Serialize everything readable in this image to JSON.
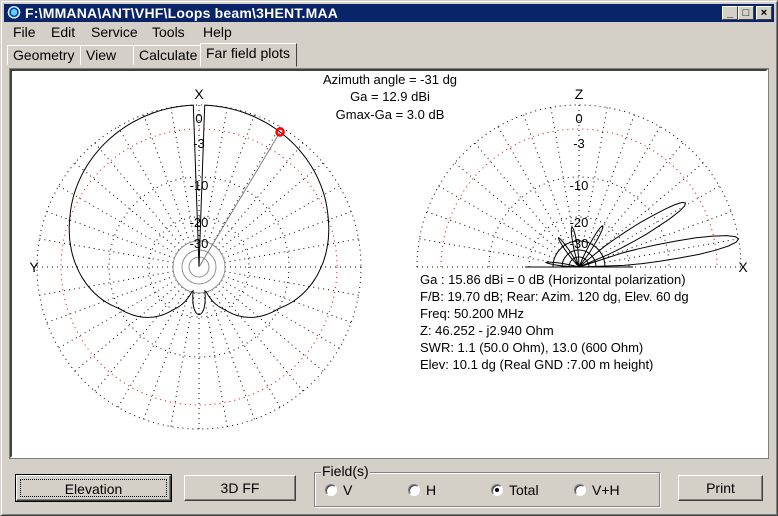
{
  "window": {
    "title": "F:\\MMANA\\ANT\\VHF\\Loops beam\\3HENT.MAA",
    "controls": {
      "minimize": "_",
      "maximize": "□",
      "close": "×"
    }
  },
  "menu": [
    "File",
    "Edit",
    "Service",
    "Tools",
    "Help"
  ],
  "tabs": [
    {
      "label": "Geometry",
      "active": false
    },
    {
      "label": "View",
      "active": false
    },
    {
      "label": "Calculate",
      "active": false
    },
    {
      "label": "Far field plots",
      "active": true
    }
  ],
  "header_info": {
    "azimuth": "Azimuth angle = -31 dg",
    "ga": "Ga = 12.9 dBi",
    "gmax": "Gmax-Ga = 3.0 dB"
  },
  "azimuth_plot": {
    "axis_top": "X",
    "axis_left": "Y",
    "ring_labels": [
      "0",
      "-3",
      "-10",
      "-20",
      "-30"
    ],
    "marker_azimuth_dg": -31,
    "marker_color": "#ff0000"
  },
  "elevation_plot": {
    "axis_top": "Z",
    "axis_right": "X",
    "ring_labels": [
      "0",
      "-3",
      "-10",
      "-20",
      "-30"
    ]
  },
  "results": [
    "Ga : 15.86 dBi = 0 dB  (Horizontal polarization)",
    "F/B: 19.70 dB; Rear: Azim. 120 dg,  Elev. 60 dg",
    "Freq: 50.200 MHz",
    "Z: 46.252 - j2.940 Ohm",
    "SWR: 1.1 (50.0 Ohm), 13.0 (600 Ohm)",
    "Elev: 10.1 dg (Real GND  :7.00 m height)"
  ],
  "colors": {
    "grid": "#000000",
    "minus3_ring": "#e00000",
    "pattern": "#000000",
    "center_rings": "#909090",
    "titlebar": "#0a246a"
  },
  "bottom": {
    "elevation_button": "Elevation",
    "ff3d_button": "3D FF",
    "fields_label": "Field(s)",
    "fields": [
      {
        "label": "V",
        "selected": false
      },
      {
        "label": "H",
        "selected": false
      },
      {
        "label": "Total",
        "selected": true
      },
      {
        "label": "V+H",
        "selected": false
      }
    ],
    "print_button": "Print"
  }
}
